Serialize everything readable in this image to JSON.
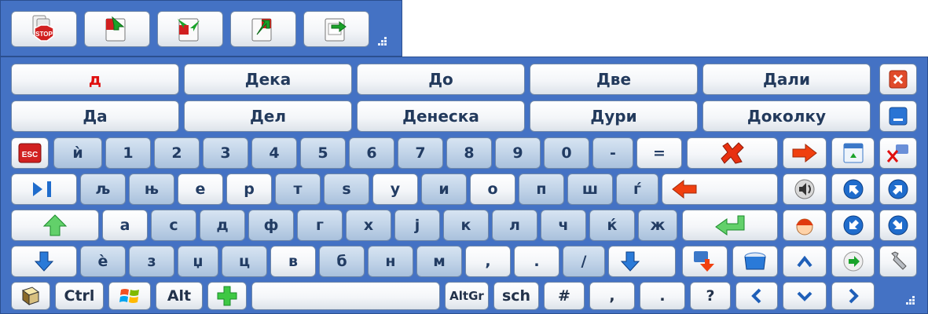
{
  "suggestions": {
    "row1": [
      "д",
      "Дека",
      "До",
      "Две",
      "Дали"
    ],
    "row2": [
      "Да",
      "Дел",
      "Денеска",
      "Дури",
      "Доколку"
    ]
  },
  "row3": [
    "ѝ",
    "1",
    "2",
    "3",
    "4",
    "5",
    "6",
    "7",
    "8",
    "9",
    "0",
    "-",
    "="
  ],
  "row4": [
    "љ",
    "њ",
    "е",
    "р",
    "т",
    "ѕ",
    "у",
    "и",
    "о",
    "п",
    "ш",
    "ѓ"
  ],
  "row5": [
    "а",
    "с",
    "д",
    "ф",
    "г",
    "х",
    "ј",
    "к",
    "л",
    "ч",
    "ќ",
    "ж"
  ],
  "row6": [
    "ѐ",
    "з",
    "џ",
    "ц",
    "в",
    "б",
    "н",
    "м",
    ",",
    ".",
    "/"
  ],
  "row7": {
    "ctrl": "Ctrl",
    "alt": "Alt",
    "altgr": "AltGr",
    "sch": "sch",
    "hash": "#",
    "comma": ",",
    "period": ".",
    "question": "?"
  },
  "esc_label": "ESC",
  "stop_label": "STOP",
  "icons": {
    "toolbar": [
      "stop-icon",
      "dock-icon",
      "dock-both-icon",
      "undock-icon",
      "float-icon"
    ],
    "nav": [
      "close-icon",
      "minimize-icon",
      "delete-word-icon",
      "forward-arrow-icon",
      "window-icon",
      "spellcheck-icon",
      "sound-icon",
      "arrow-up-left-icon",
      "arrow-up-right-icon",
      "arrow-down-left-icon",
      "arrow-down-right-icon",
      "face-icon",
      "text-select-icon",
      "bucket-icon",
      "forward-circle-icon",
      "settings-icon"
    ]
  },
  "colors": {
    "panel": "#4472c4",
    "red_suggestion": "#e01010",
    "accent_arrow": "#1f6ccc"
  }
}
